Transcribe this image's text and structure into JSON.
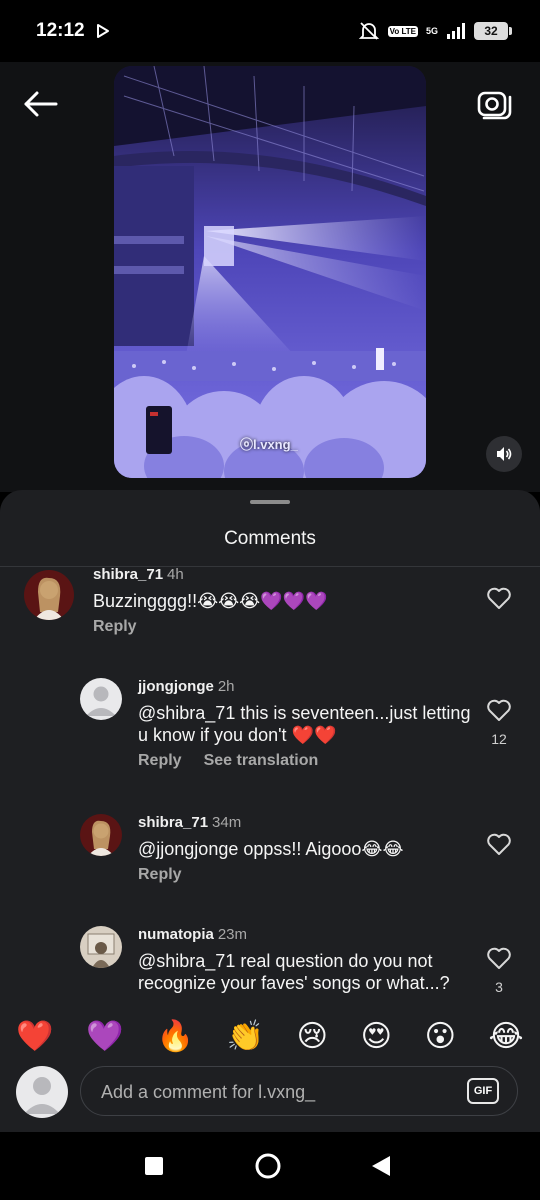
{
  "status": {
    "time": "12:12",
    "volte": "Vo LTE",
    "network": "5G",
    "battery": "32"
  },
  "media": {
    "watermark": "ⓞl.vxng_"
  },
  "comments_sheet": {
    "title": "Comments",
    "comments": [
      {
        "username": "shibra_71",
        "time": "4h",
        "text": "Buzzingggg!!😭😭😭💜💜💜",
        "actions": [
          "Reply"
        ],
        "likes": ""
      },
      {
        "username": "jjongjonge",
        "time": "2h",
        "text": "@shibra_71 this is seventeen...just letting u know if you don't ❤️❤️",
        "actions": [
          "Reply",
          "See translation"
        ],
        "likes": "12"
      },
      {
        "username": "shibra_71",
        "time": "34m",
        "text": "@jjongjonge oppss!! Aigooo😂😂",
        "actions": [
          "Reply"
        ],
        "likes": ""
      },
      {
        "username": "numatopia",
        "time": "23m",
        "text": "@shibra_71 real question do you not recognize your faves' songs or what...?",
        "actions": [],
        "likes": "3"
      }
    ]
  },
  "quick_reactions": [
    "❤️",
    "💜",
    "🔥",
    "👏",
    "😢",
    "😍",
    "😮",
    "😂"
  ],
  "composer": {
    "placeholder": "Add a comment for l.vxng_",
    "gif_label": "GIF"
  },
  "colors": {
    "sheet_bg": "#1e1f22",
    "muted_text": "#a8a8a8",
    "stage_purple": "#5b4fd6"
  }
}
